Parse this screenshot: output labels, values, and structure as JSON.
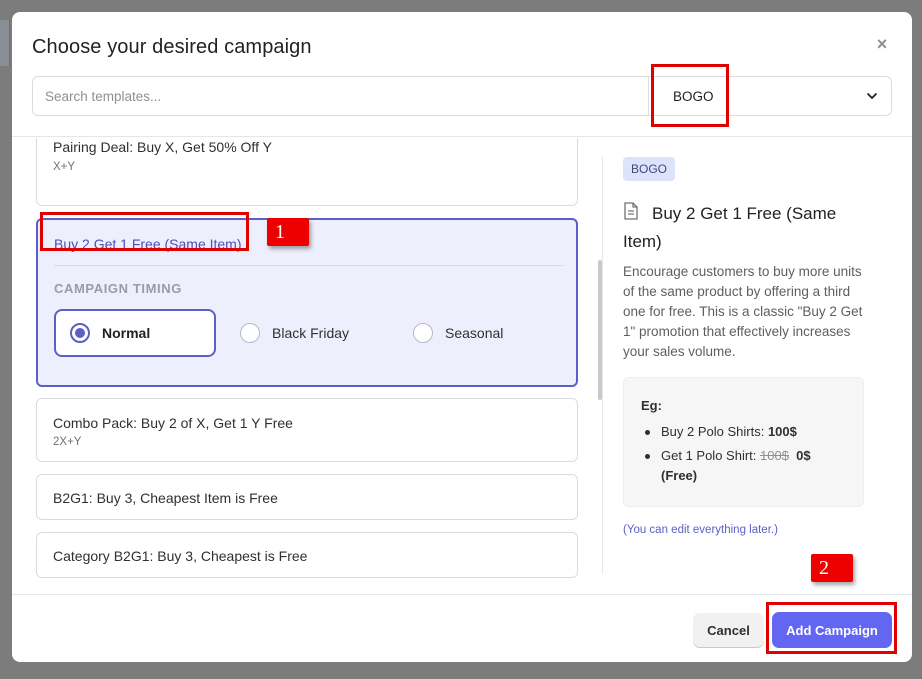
{
  "modal": {
    "title": "Choose your desired campaign",
    "close_symbol": "×"
  },
  "search": {
    "placeholder": "Search templates..."
  },
  "filter_select": {
    "value": "BOGO"
  },
  "annotations": {
    "badge_1": "1",
    "badge_2": "2"
  },
  "campaign_list": {
    "partial_card": {
      "title": "Pairing Deal: Buy X, Get 50% Off Y",
      "subtitle": "X+Y"
    },
    "selected_card": {
      "title": "Buy 2 Get 1 Free (Same Item)",
      "timing_label": "CAMPAIGN TIMING",
      "timing_options": [
        {
          "label": "Normal",
          "selected": true
        },
        {
          "label": "Black Friday",
          "selected": false
        },
        {
          "label": "Seasonal",
          "selected": false
        }
      ]
    },
    "cards": [
      {
        "title": "Combo Pack: Buy 2 of X, Get 1 Y Free",
        "subtitle": "2X+Y"
      },
      {
        "title": "B2G1: Buy 3, Cheapest Item is Free",
        "subtitle": ""
      },
      {
        "title": "Category B2G1: Buy 3, Cheapest is Free",
        "subtitle": ""
      }
    ]
  },
  "detail": {
    "tag": "BOGO",
    "icon": "document-icon",
    "title": "Buy 2 Get 1 Free (Same Item)",
    "description": "Encourage customers to buy more units of the same product by offering a third one for free. This is a classic \"Buy 2 Get 1\" promotion that effectively increases your sales volume.",
    "example": {
      "title": "Eg:",
      "item1_text": "Buy 2 Polo Shirts: ",
      "item1_value": "100$",
      "item2_text": "Get 1 Polo Shirt: ",
      "item2_old_price": "100$",
      "item2_new_price": "0$",
      "item2_note": "(Free)"
    },
    "edit_note": "(You can edit everything later.)"
  },
  "footer": {
    "cancel_label": "Cancel",
    "add_label": "Add Campaign"
  },
  "colors": {
    "accent": "#6366f1",
    "selected_border": "#5c5fc5",
    "selected_bg": "#eeeffd",
    "annotation_red": "#e00000"
  }
}
